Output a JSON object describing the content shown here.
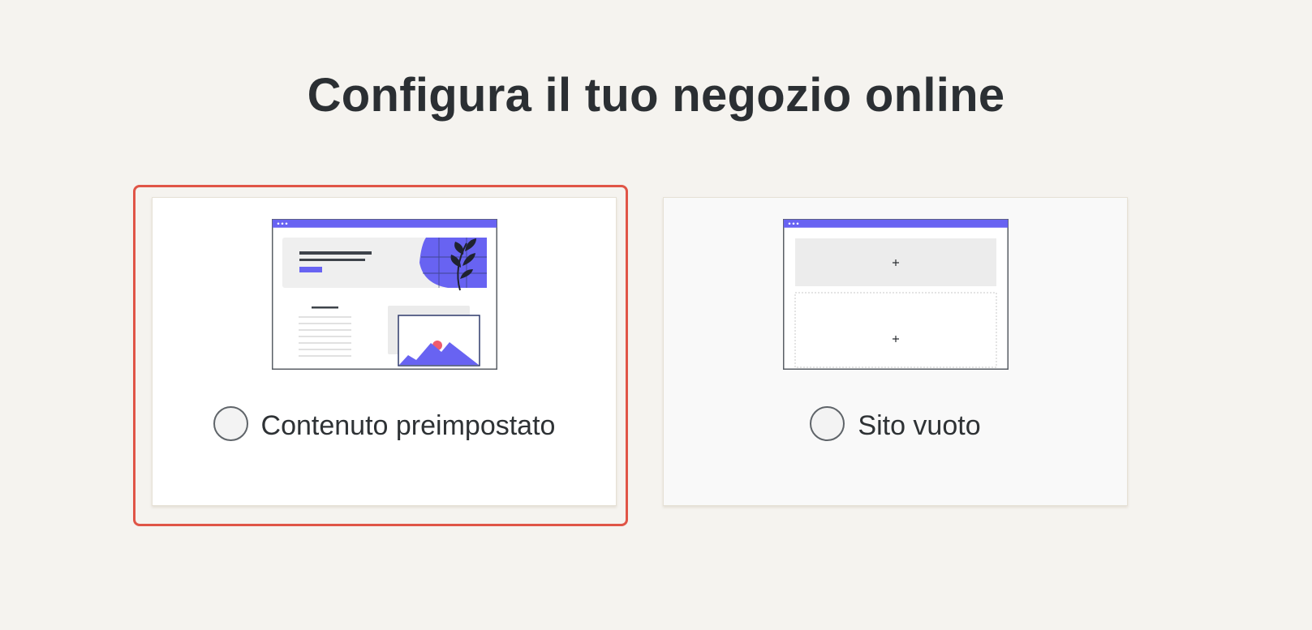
{
  "page": {
    "title": "Configura il tuo negozio online"
  },
  "options": [
    {
      "label": "Contenuto preimpostato",
      "illustration": "prefilled-site-preview",
      "selected": false,
      "highlighted": true
    },
    {
      "label": "Sito vuoto",
      "illustration": "blank-site-preview",
      "selected": false,
      "highlighted": false
    }
  ],
  "colors": {
    "background": "#f5f3ef",
    "accent": "#6863f2",
    "highlight_border": "#e05547",
    "text": "#2b2f33"
  }
}
